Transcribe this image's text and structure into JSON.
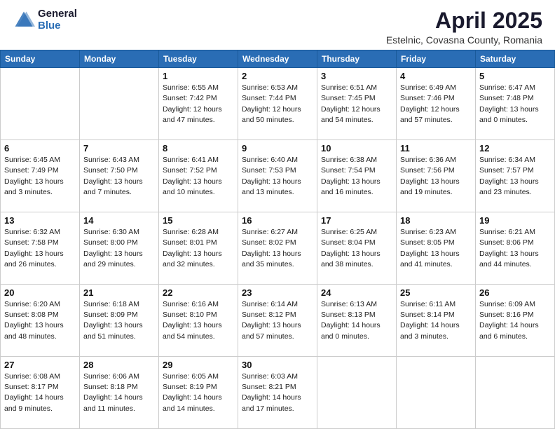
{
  "header": {
    "logo_general": "General",
    "logo_blue": "Blue",
    "title": "April 2025",
    "location": "Estelnic, Covasna County, Romania"
  },
  "weekdays": [
    "Sunday",
    "Monday",
    "Tuesday",
    "Wednesday",
    "Thursday",
    "Friday",
    "Saturday"
  ],
  "weeks": [
    [
      {
        "day": "",
        "info": ""
      },
      {
        "day": "",
        "info": ""
      },
      {
        "day": "1",
        "info": "Sunrise: 6:55 AM\nSunset: 7:42 PM\nDaylight: 12 hours\nand 47 minutes."
      },
      {
        "day": "2",
        "info": "Sunrise: 6:53 AM\nSunset: 7:44 PM\nDaylight: 12 hours\nand 50 minutes."
      },
      {
        "day": "3",
        "info": "Sunrise: 6:51 AM\nSunset: 7:45 PM\nDaylight: 12 hours\nand 54 minutes."
      },
      {
        "day": "4",
        "info": "Sunrise: 6:49 AM\nSunset: 7:46 PM\nDaylight: 12 hours\nand 57 minutes."
      },
      {
        "day": "5",
        "info": "Sunrise: 6:47 AM\nSunset: 7:48 PM\nDaylight: 13 hours\nand 0 minutes."
      }
    ],
    [
      {
        "day": "6",
        "info": "Sunrise: 6:45 AM\nSunset: 7:49 PM\nDaylight: 13 hours\nand 3 minutes."
      },
      {
        "day": "7",
        "info": "Sunrise: 6:43 AM\nSunset: 7:50 PM\nDaylight: 13 hours\nand 7 minutes."
      },
      {
        "day": "8",
        "info": "Sunrise: 6:41 AM\nSunset: 7:52 PM\nDaylight: 13 hours\nand 10 minutes."
      },
      {
        "day": "9",
        "info": "Sunrise: 6:40 AM\nSunset: 7:53 PM\nDaylight: 13 hours\nand 13 minutes."
      },
      {
        "day": "10",
        "info": "Sunrise: 6:38 AM\nSunset: 7:54 PM\nDaylight: 13 hours\nand 16 minutes."
      },
      {
        "day": "11",
        "info": "Sunrise: 6:36 AM\nSunset: 7:56 PM\nDaylight: 13 hours\nand 19 minutes."
      },
      {
        "day": "12",
        "info": "Sunrise: 6:34 AM\nSunset: 7:57 PM\nDaylight: 13 hours\nand 23 minutes."
      }
    ],
    [
      {
        "day": "13",
        "info": "Sunrise: 6:32 AM\nSunset: 7:58 PM\nDaylight: 13 hours\nand 26 minutes."
      },
      {
        "day": "14",
        "info": "Sunrise: 6:30 AM\nSunset: 8:00 PM\nDaylight: 13 hours\nand 29 minutes."
      },
      {
        "day": "15",
        "info": "Sunrise: 6:28 AM\nSunset: 8:01 PM\nDaylight: 13 hours\nand 32 minutes."
      },
      {
        "day": "16",
        "info": "Sunrise: 6:27 AM\nSunset: 8:02 PM\nDaylight: 13 hours\nand 35 minutes."
      },
      {
        "day": "17",
        "info": "Sunrise: 6:25 AM\nSunset: 8:04 PM\nDaylight: 13 hours\nand 38 minutes."
      },
      {
        "day": "18",
        "info": "Sunrise: 6:23 AM\nSunset: 8:05 PM\nDaylight: 13 hours\nand 41 minutes."
      },
      {
        "day": "19",
        "info": "Sunrise: 6:21 AM\nSunset: 8:06 PM\nDaylight: 13 hours\nand 44 minutes."
      }
    ],
    [
      {
        "day": "20",
        "info": "Sunrise: 6:20 AM\nSunset: 8:08 PM\nDaylight: 13 hours\nand 48 minutes."
      },
      {
        "day": "21",
        "info": "Sunrise: 6:18 AM\nSunset: 8:09 PM\nDaylight: 13 hours\nand 51 minutes."
      },
      {
        "day": "22",
        "info": "Sunrise: 6:16 AM\nSunset: 8:10 PM\nDaylight: 13 hours\nand 54 minutes."
      },
      {
        "day": "23",
        "info": "Sunrise: 6:14 AM\nSunset: 8:12 PM\nDaylight: 13 hours\nand 57 minutes."
      },
      {
        "day": "24",
        "info": "Sunrise: 6:13 AM\nSunset: 8:13 PM\nDaylight: 14 hours\nand 0 minutes."
      },
      {
        "day": "25",
        "info": "Sunrise: 6:11 AM\nSunset: 8:14 PM\nDaylight: 14 hours\nand 3 minutes."
      },
      {
        "day": "26",
        "info": "Sunrise: 6:09 AM\nSunset: 8:16 PM\nDaylight: 14 hours\nand 6 minutes."
      }
    ],
    [
      {
        "day": "27",
        "info": "Sunrise: 6:08 AM\nSunset: 8:17 PM\nDaylight: 14 hours\nand 9 minutes."
      },
      {
        "day": "28",
        "info": "Sunrise: 6:06 AM\nSunset: 8:18 PM\nDaylight: 14 hours\nand 11 minutes."
      },
      {
        "day": "29",
        "info": "Sunrise: 6:05 AM\nSunset: 8:19 PM\nDaylight: 14 hours\nand 14 minutes."
      },
      {
        "day": "30",
        "info": "Sunrise: 6:03 AM\nSunset: 8:21 PM\nDaylight: 14 hours\nand 17 minutes."
      },
      {
        "day": "",
        "info": ""
      },
      {
        "day": "",
        "info": ""
      },
      {
        "day": "",
        "info": ""
      }
    ]
  ]
}
